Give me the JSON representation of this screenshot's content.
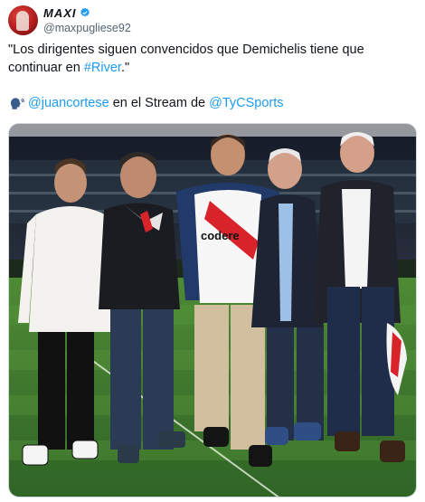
{
  "author": {
    "display_name": "MAXI",
    "handle": "@maxpugliese92",
    "avatar": "avatar-photo",
    "verified_icon": "verified-badge-icon"
  },
  "tweet": {
    "text_line": "\"Los dirigentes siguen convencidos que Demichelis tiene que continuar en ",
    "hashtag": "#River",
    "text_end": ".\"",
    "speaker_icon": "speaking-head-icon",
    "mention1": "@juancortese",
    "mid_text": " en el Stream de ",
    "mention2": "@TyCSports"
  },
  "photo": {
    "description_icon": "photo",
    "sponsor_text": "codere"
  },
  "colors": {
    "link": "#1d9bf0",
    "verified": "#1d9bf0",
    "grass": "#3f7a2e",
    "river_red": "#d8232a"
  }
}
